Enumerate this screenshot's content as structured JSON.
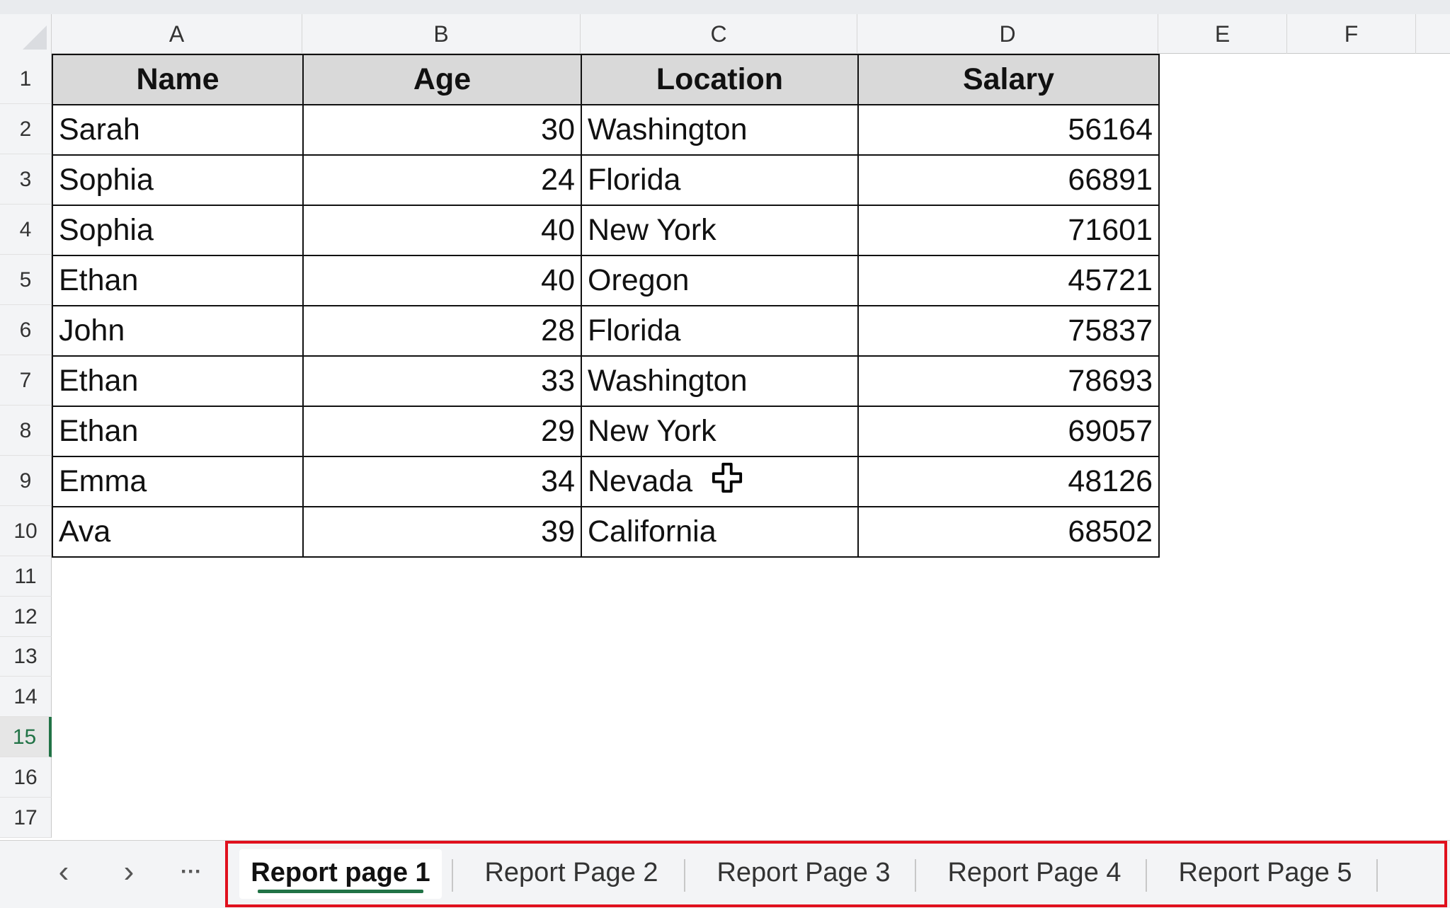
{
  "column_headers": [
    "A",
    "B",
    "C",
    "D",
    "E",
    "F"
  ],
  "row_numbers": [
    "1",
    "2",
    "3",
    "4",
    "5",
    "6",
    "7",
    "8",
    "9",
    "10",
    "11",
    "12",
    "13",
    "14",
    "15",
    "16",
    "17"
  ],
  "active_row": "15",
  "table": {
    "headers": [
      "Name",
      "Age",
      "Location",
      "Salary"
    ],
    "rows": [
      [
        "Sarah",
        "30",
        "Washington",
        "56164"
      ],
      [
        "Sophia",
        "24",
        "Florida",
        "66891"
      ],
      [
        "Sophia",
        "40",
        "New York",
        "71601"
      ],
      [
        "Ethan",
        "40",
        "Oregon",
        "45721"
      ],
      [
        "John",
        "28",
        "Florida",
        "75837"
      ],
      [
        "Ethan",
        "33",
        "Washington",
        "78693"
      ],
      [
        "Ethan",
        "29",
        "New York",
        "69057"
      ],
      [
        "Emma",
        "34",
        "Nevada",
        "48126"
      ],
      [
        "Ava",
        "39",
        "California",
        "68502"
      ]
    ]
  },
  "sheet_nav": {
    "prev": "‹",
    "next": "›",
    "more": "···"
  },
  "sheet_tabs": [
    {
      "label": "Report page 1",
      "active": true
    },
    {
      "label": "Report Page 2",
      "active": false
    },
    {
      "label": "Report Page 3",
      "active": false
    },
    {
      "label": "Report Page 4",
      "active": false
    },
    {
      "label": "Report Page 5",
      "active": false
    }
  ],
  "colors": {
    "accent": "#217346",
    "highlight_outline": "#e0101d",
    "header_fill": "#d9d9d9"
  },
  "icons": {
    "cursor": "move-cross-cursor-icon"
  }
}
